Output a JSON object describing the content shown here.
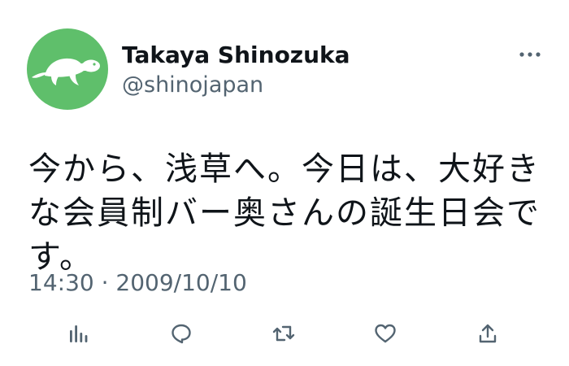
{
  "author": {
    "display_name": "Takaya Shinozuka",
    "handle": "@shinojapan",
    "avatar_icon": "turtle-icon",
    "avatar_bg": "#5fbf6b"
  },
  "tweet": {
    "text": "今から、浅草へ。今日は、大好きな会員制バー奥さんの誕生日会です。",
    "timestamp": "14:30 · 2009/10/10"
  },
  "actions": [
    {
      "icon": "analytics-icon"
    },
    {
      "icon": "reply-icon"
    },
    {
      "icon": "retweet-icon"
    },
    {
      "icon": "like-icon"
    },
    {
      "icon": "share-icon"
    }
  ],
  "more_icon": "more-icon",
  "colors": {
    "text": "#0f1419",
    "secondary": "#536471",
    "background": "#ffffff"
  }
}
